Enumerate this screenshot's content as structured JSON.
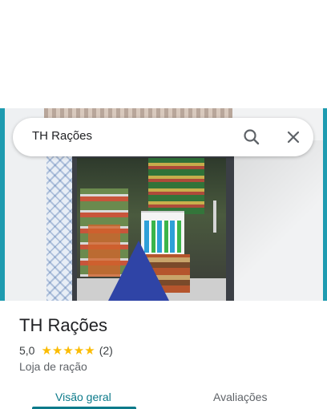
{
  "search": {
    "query": "TH Rações"
  },
  "place": {
    "name": "TH Rações",
    "rating": "5,0",
    "stars": "★★★★★",
    "review_count": "(2)",
    "category": "Loja de ração"
  },
  "tabs": [
    {
      "label": "Visão geral",
      "active": true
    },
    {
      "label": "Avaliações",
      "active": false
    }
  ],
  "colors": {
    "accent": "#0b7a8a",
    "star": "#fbbc04"
  },
  "icons": {
    "search": "search-icon",
    "close": "close-icon"
  }
}
